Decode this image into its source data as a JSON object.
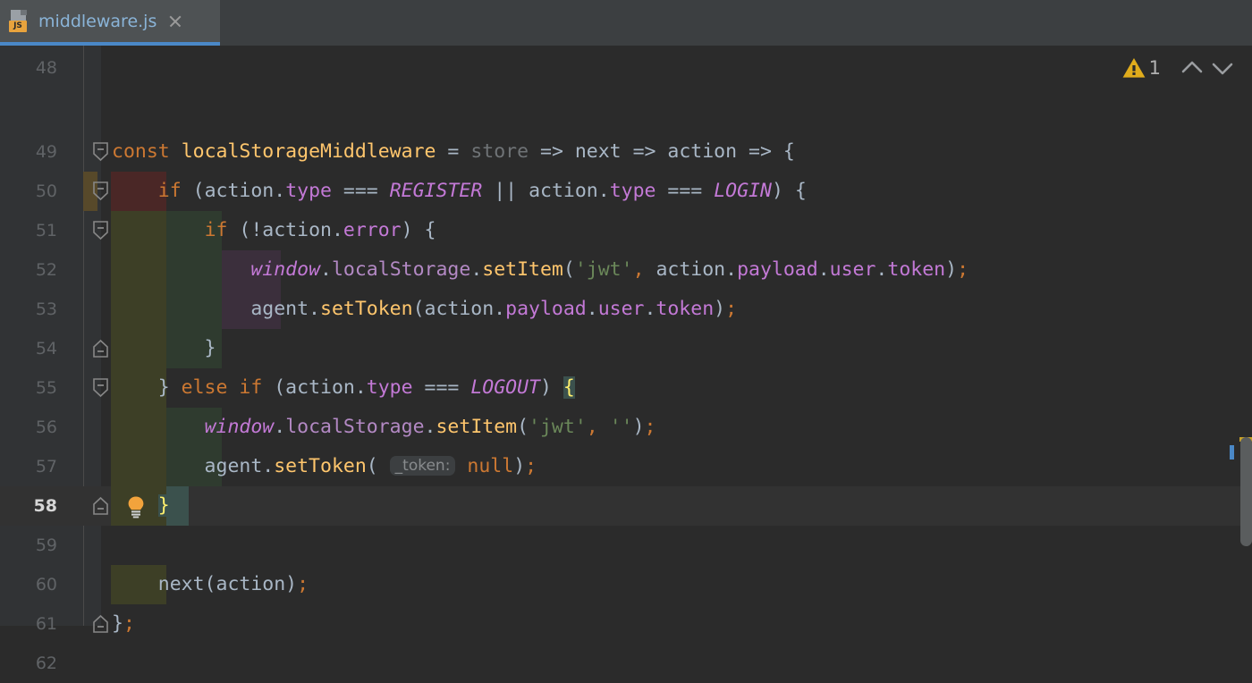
{
  "window": {
    "theme": "darcula",
    "background": "#2b2b2b"
  },
  "tab": {
    "filename": "middleware.js",
    "icon": "javascript-file-icon",
    "icon_badge": "JS",
    "close_label": "×",
    "active": true,
    "underline_color": "#4a88c7"
  },
  "inspection_widget": {
    "warning_icon": "warning-triangle-icon",
    "warning_count": "1",
    "prev_icon": "chevron-up-icon",
    "next_icon": "chevron-down-icon"
  },
  "editor": {
    "current_line": 58,
    "first_visible_line": 48,
    "last_visible_line": 62,
    "colors": {
      "keyword": "#cc7832",
      "function": "#ffc66d",
      "string": "#6a8759",
      "property": "#c379d6",
      "plain": "#a9b7c6",
      "dimmed": "#6f7376",
      "brace_match_bg": "#3b514d",
      "brace_match_fg": "#ffef6d",
      "gutter_bg": "#313335",
      "current_line_bg": "#323232"
    },
    "lines": [
      {
        "n": "48",
        "fold": "none",
        "text": ""
      },
      {
        "n": "49",
        "fold": "start",
        "text": "const localStorageMiddleware = store => next => action => {"
      },
      {
        "n": "50",
        "fold": "start",
        "text": "    if (action.type === REGISTER || action.type === LOGIN) {"
      },
      {
        "n": "51",
        "fold": "start",
        "text": "        if (!action.error) {"
      },
      {
        "n": "52",
        "fold": "none",
        "text": "            window.localStorage.setItem('jwt', action.payload.user.token);"
      },
      {
        "n": "53",
        "fold": "none",
        "text": "            agent.setToken(action.payload.user.token);"
      },
      {
        "n": "54",
        "fold": "end",
        "text": "        }"
      },
      {
        "n": "55",
        "fold": "start",
        "text": "    } else if (action.type === LOGOUT) {"
      },
      {
        "n": "56",
        "fold": "none",
        "text": "        window.localStorage.setItem('jwt', '');"
      },
      {
        "n": "57",
        "fold": "none",
        "text": "        agent.setToken( _token: null);"
      },
      {
        "n": "58",
        "fold": "end",
        "text": "    }"
      },
      {
        "n": "59",
        "fold": "none",
        "text": ""
      },
      {
        "n": "60",
        "fold": "none",
        "text": "    next(action);"
      },
      {
        "n": "61",
        "fold": "end",
        "text": "};"
      },
      {
        "n": "62",
        "fold": "none",
        "text": ""
      }
    ],
    "inlay_hints": [
      {
        "line": "57",
        "label": "_token:"
      }
    ],
    "intention_bulb": {
      "line": "58",
      "icon": "lightbulb-icon"
    }
  },
  "scrollbar": {
    "warning_marker_color": "#c9a227",
    "info_marker_color": "#4a88c7",
    "thumb_color": "#5a5d5e"
  }
}
